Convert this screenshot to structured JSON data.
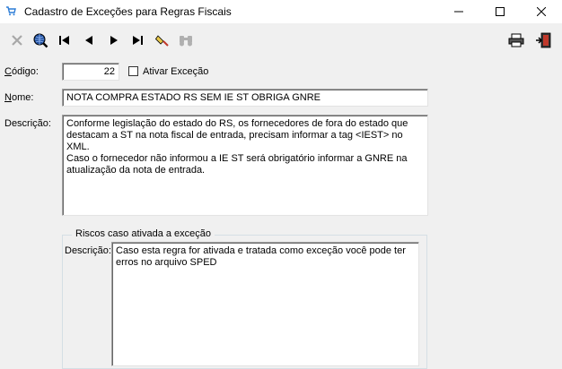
{
  "window": {
    "title": "Cadastro de Exceções para Regras Fiscais",
    "minimize_icon": "minimize-icon",
    "maximize_icon": "maximize-icon",
    "close_icon": "close-icon"
  },
  "toolbar": {
    "buttons": [
      {
        "icon": "cancel-x-icon",
        "enabled": false
      },
      {
        "icon": "globe-search-icon",
        "enabled": true
      },
      {
        "icon": "first-record-icon",
        "enabled": true
      },
      {
        "icon": "previous-record-icon",
        "enabled": true
      },
      {
        "icon": "next-record-icon",
        "enabled": true
      },
      {
        "icon": "last-record-icon",
        "enabled": true
      },
      {
        "icon": "eraser-icon",
        "enabled": true
      },
      {
        "icon": "binoculars-icon",
        "enabled": false
      },
      {
        "icon": "printer-icon",
        "enabled": true
      },
      {
        "icon": "exit-door-icon",
        "enabled": true
      }
    ]
  },
  "form": {
    "codigo_label_u": "C",
    "codigo_label_rest": "ódigo:",
    "codigo_value": "22",
    "ativar_label": "Ativar Exceção",
    "nome_label_u": "N",
    "nome_label_rest": "ome:",
    "nome_value": "NOTA COMPRA ESTADO RS SEM IE ST OBRIGA GNRE",
    "descricao_label": "Descrição:",
    "descricao_value": "Conforme legislação do estado do RS, os fornecedores de fora do estado que\ndestacam a ST na nota fiscal de entrada, precisam informar a tag <IEST> no XML.\nCaso o fornecedor não informou a IE ST será obrigatório informar a GNRE na\natualização da nota de entrada."
  },
  "riscos": {
    "group_title": "Riscos caso ativada a exceção",
    "descricao_label": "Descrição:",
    "descricao_value": "Caso esta regra for ativada e tratada como exceção você pode ter\nerros no arquivo SPED"
  },
  "colors": {
    "window_bg": "#f0f0f0",
    "titlebar_bg": "#ffffff",
    "accent_blue": "#1f4e9c",
    "exit_red": "#c0392b"
  }
}
